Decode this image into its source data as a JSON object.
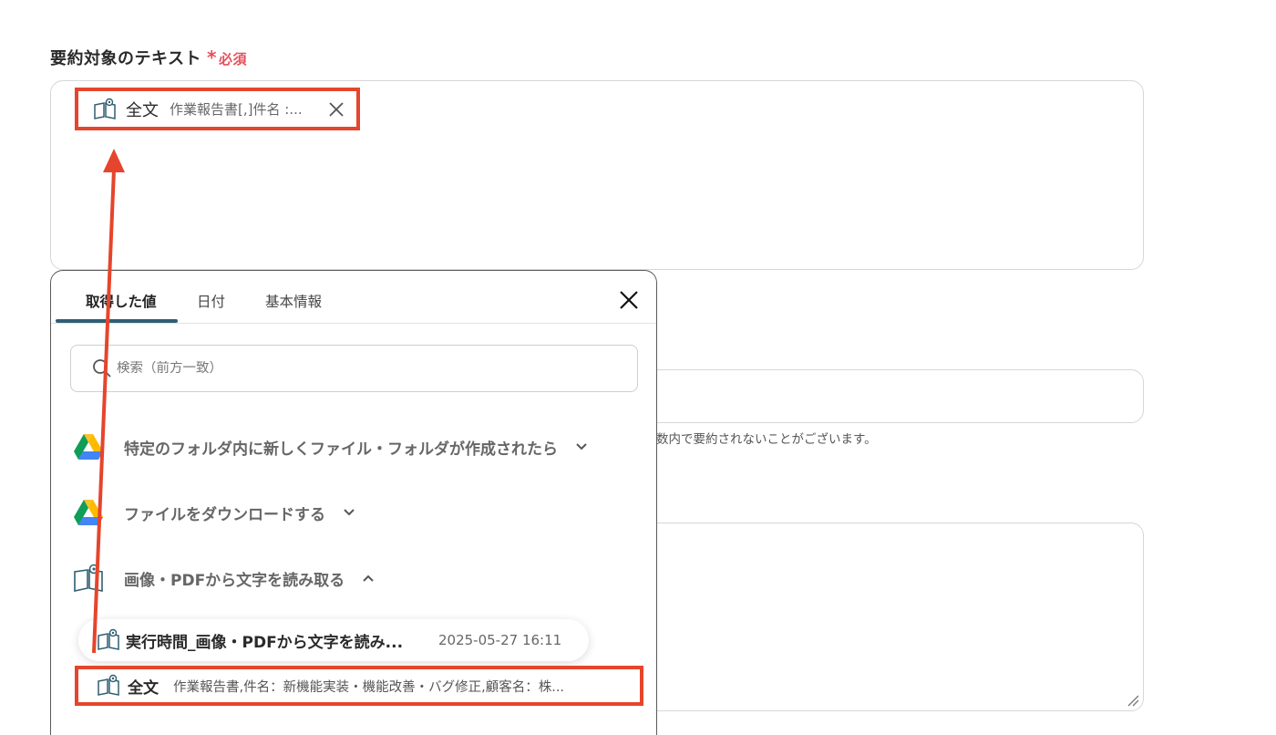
{
  "field": {
    "label": "要約対象のテキスト",
    "required_mark": "*",
    "required_text": "必須"
  },
  "token": {
    "icon": "ocr-book-icon",
    "name": "全文",
    "value": "作業報告書[,]件名 :..."
  },
  "background": {
    "help_text": "数内で要約されないことがございます。"
  },
  "panel": {
    "tabs": [
      {
        "label": "取得した値"
      },
      {
        "label": "日付"
      },
      {
        "label": "基本情報"
      }
    ],
    "search": {
      "placeholder": "検索（前方一致）"
    },
    "sections": [
      {
        "label": "特定のフォルダ内に新しくファイル・フォルダが作成されたら",
        "icon": "google-drive-icon",
        "expanded": false
      },
      {
        "label": "ファイルをダウンロードする",
        "icon": "google-drive-icon",
        "expanded": false
      },
      {
        "label": "画像・PDFから文字を読み取る",
        "icon": "ocr-book-icon",
        "expanded": true
      }
    ],
    "result": {
      "name": "実行時間_画像・PDFから文字を読み...",
      "time": "2025-05-27 16:11"
    },
    "value_item": {
      "name": "全文",
      "value": "作業報告書,件名：新機能実装・機能改善・バグ修正,顧客名：株..."
    }
  },
  "colors": {
    "highlight": "#e5452c",
    "required": "#e4505a",
    "tab_underline": "#2f5f73"
  }
}
